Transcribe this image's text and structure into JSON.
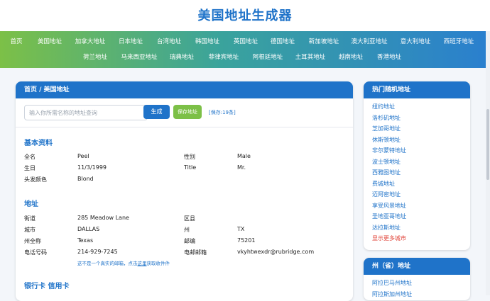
{
  "site": {
    "title": "美国地址生成器"
  },
  "nav": {
    "row1": [
      "首页",
      "美国地址",
      "加拿大地址",
      "日本地址",
      "台湾地址",
      "韩国地址",
      "英国地址",
      "德国地址",
      "新加坡地址",
      "澳大利亚地址",
      "意大利地址",
      "西班牙地址"
    ],
    "row2": [
      "荷兰地址",
      "马来西亚地址",
      "瑞典地址",
      "菲律宾地址",
      "阿根廷地址",
      "土耳其地址",
      "越南地址",
      "香港地址"
    ]
  },
  "breadcrumb": "首页 / 美国地址",
  "search": {
    "placeholder": "输入你所需名称的地址查询",
    "generate_label": "生成",
    "save_label": "保存地址",
    "saved_text": "[保存:19条]"
  },
  "basic_info": {
    "title": "基本资料",
    "fields": [
      {
        "label": "全名",
        "value": "Peel"
      },
      {
        "label": "性别",
        "value": "Male"
      },
      {
        "label": "生日",
        "value": "11/3/1999"
      },
      {
        "label": "Title",
        "value": "Mr."
      },
      {
        "label": "头发颜色",
        "value": "Blond"
      }
    ]
  },
  "address": {
    "title": "地址",
    "fields": [
      {
        "label": "街道",
        "value": "285 Meadow Lane"
      },
      {
        "label": "区县",
        "value": ""
      },
      {
        "label": "城市",
        "value": "DALLAS"
      },
      {
        "label": "州",
        "value": "TX"
      },
      {
        "label": "州全称",
        "value": "Texas"
      },
      {
        "label": "邮编",
        "value": "75201"
      },
      {
        "label": "电话号码",
        "value": "214-929-7245"
      },
      {
        "label": "电邮邮箱",
        "value": "vkyhtwexdr@rubridge.com"
      }
    ],
    "note_prefix": "这不是一个真实的邮箱，点击",
    "note_link": "这里",
    "note_suffix": "获取收件件"
  },
  "bank": {
    "title": "银行卡 信用卡"
  },
  "hot_cities": {
    "title": "热门随机地址",
    "items": [
      "纽约地址",
      "洛杉矶地址",
      "芝加哥地址",
      "休斯顿地址",
      "非尔蒙特地址",
      "波士顿地址",
      "西雅图地址",
      "费城地址",
      "迈阿密地址",
      "享受风景地址",
      "圣地亚哥地址",
      "达拉斯地址"
    ],
    "more": "显示更多城市"
  },
  "states": {
    "title": "州（省）地址",
    "items": [
      "阿拉巴马州地址",
      "阿拉斯加州地址"
    ]
  },
  "colors": {
    "primary": "#1f73c9",
    "green": "#7cc047",
    "red": "#e0443a"
  }
}
